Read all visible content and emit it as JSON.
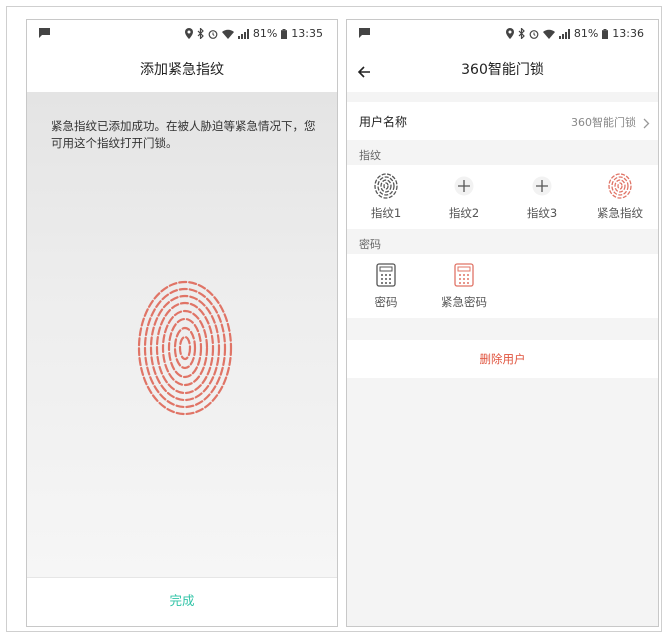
{
  "status_left": {
    "battery": "81%",
    "time": "13:35"
  },
  "status_right": {
    "battery": "81%",
    "time": "13:36"
  },
  "left_screen": {
    "title": "添加紧急指纹",
    "notice": "紧急指纹已添加成功。在被人胁迫等紧急情况下，您可用这个指纹打开门锁。",
    "done_label": "完成"
  },
  "right_screen": {
    "title": "360智能门锁",
    "username_label": "用户名称",
    "username_value": "360智能门锁",
    "fingerprint_section": "指纹",
    "fingerprints": [
      {
        "label": "指纹1",
        "icon": "fingerprint-icon"
      },
      {
        "label": "指纹2",
        "icon": "plus-icon"
      },
      {
        "label": "指纹3",
        "icon": "plus-icon"
      },
      {
        "label": "紧急指纹",
        "icon": "fingerprint-red-icon"
      }
    ],
    "password_section": "密码",
    "passwords": [
      {
        "label": "密码",
        "icon": "keypad-icon"
      },
      {
        "label": "紧急密码",
        "icon": "keypad-red-icon"
      }
    ],
    "delete_label": "删除用户"
  },
  "colors": {
    "accent_green": "#2fc3a6",
    "alert_red": "#e0533d",
    "fingerprint_red": "#e07466"
  }
}
